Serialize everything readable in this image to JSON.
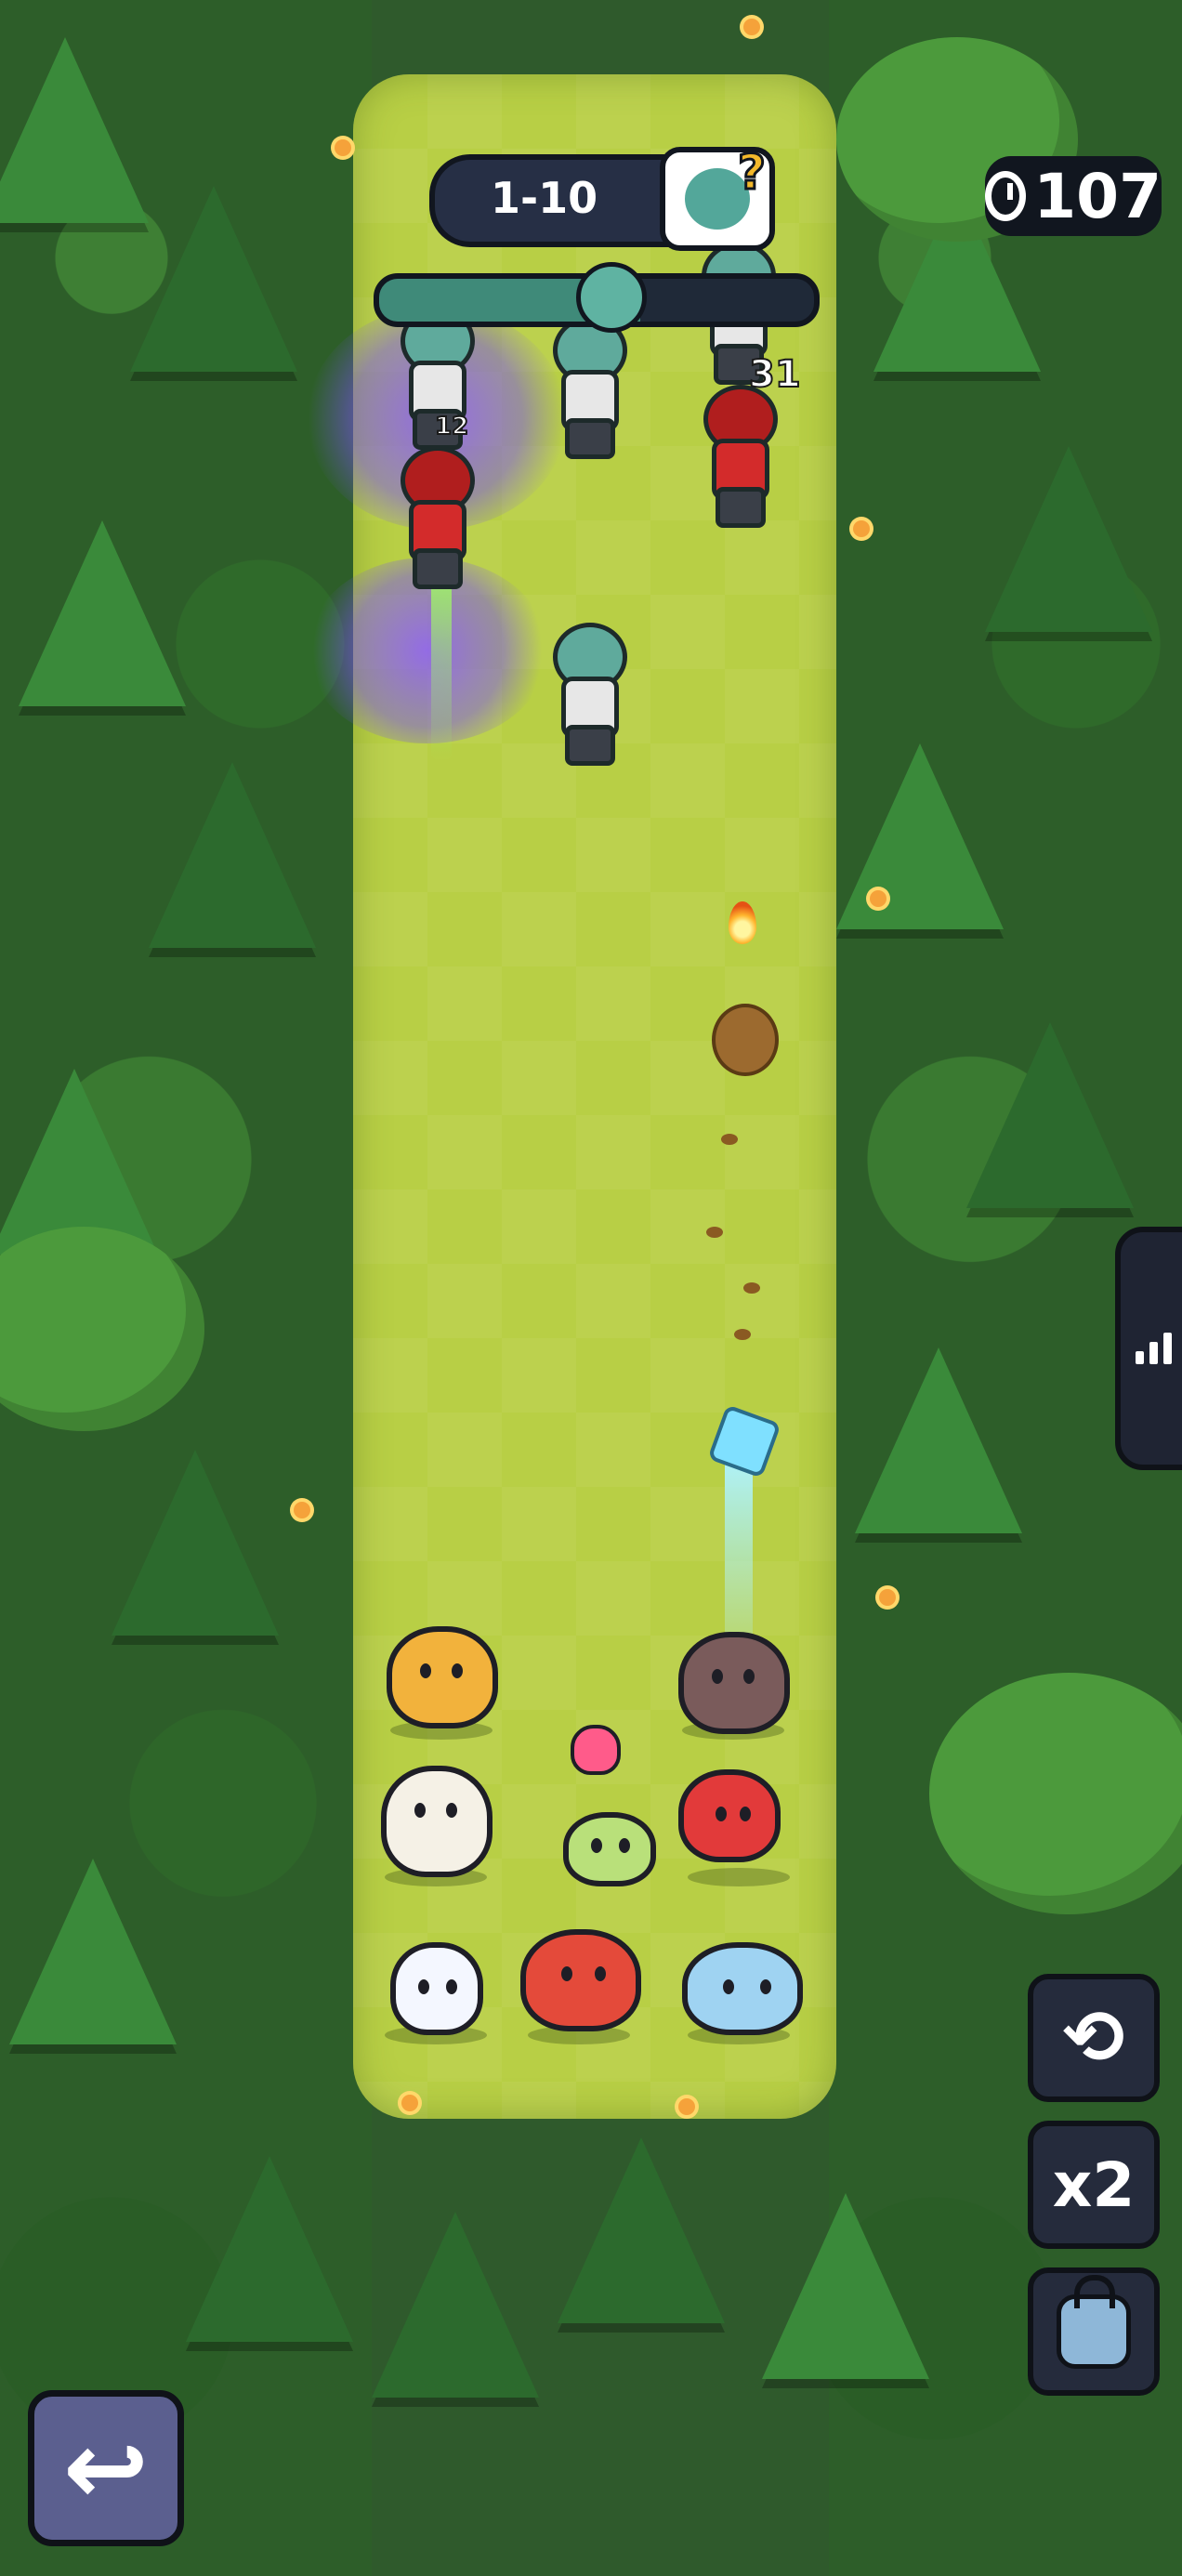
{
  "hud": {
    "stage_label": "1-10",
    "wave_progress": 0.6,
    "timer_value": "107",
    "boss_icon": "zombie-question-icon"
  },
  "damage_numbers": [
    "12",
    "31"
  ],
  "controls": {
    "speed_label": "x2",
    "refresh_icon": "refresh-icon",
    "lock_icon": "lock-icon",
    "stats_icon": "bar-chart-icon",
    "back_icon": "return-arrow-icon"
  },
  "colors": {
    "path": "#b8cf45",
    "hud_dark": "#262f45",
    "poison": "#8a5aff"
  }
}
